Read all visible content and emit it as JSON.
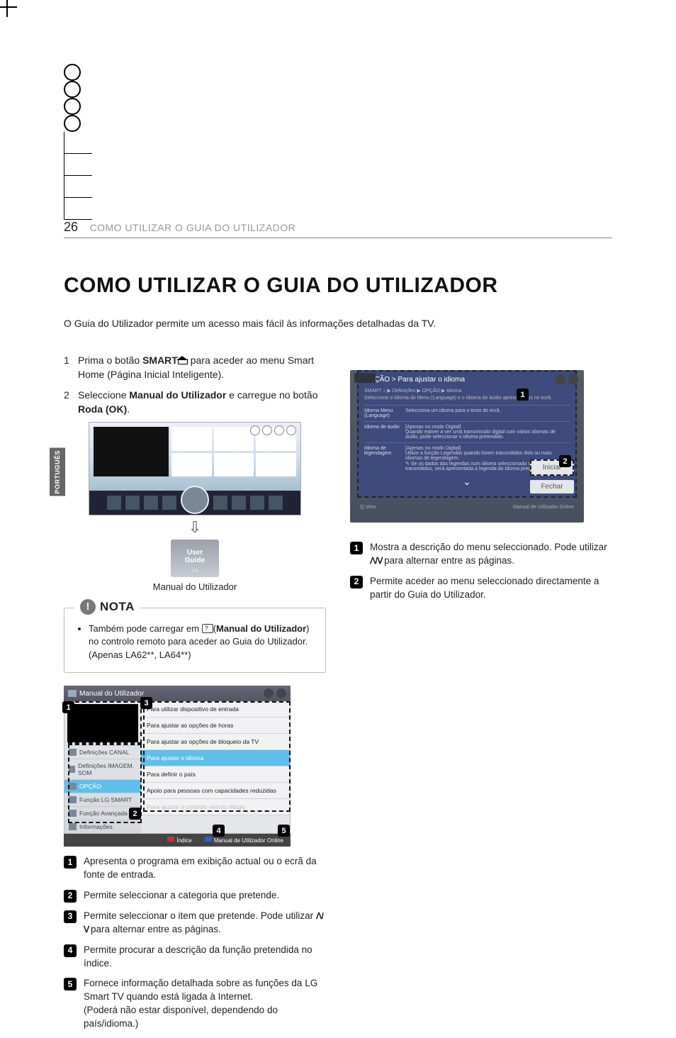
{
  "page_number": "26",
  "header_section": "COMO UTILIZAR O GUIA DO UTILIZADOR",
  "title": "COMO UTILIZAR O GUIA DO UTILIZADOR",
  "intro": "O Guia do Utilizador permite um acesso mais fácil às informações detalhadas da TV.",
  "side_tab": "PORTUGUÊS",
  "steps": [
    {
      "num": "1",
      "pre": "Prima o botão ",
      "bold": "SMART",
      "post": " para aceder ao menu Smart Home (Página Inicial Inteligente)."
    },
    {
      "num": "2",
      "pre": "Seleccione ",
      "bold": "Manual do Utilizador",
      "mid": " e carregue no botão ",
      "bold2": "Roda (OK)",
      "post": "."
    }
  ],
  "user_guide_tile": {
    "line1": "User",
    "line2": "Guide",
    "brand": "LG"
  },
  "caption1": "Manual do Utilizador",
  "note": {
    "label": "NOTA",
    "text_pre": "Também pode carregar em",
    "text_bold": "Manual do Utilizador",
    "text_mid": ") no controlo remoto para aceder ao Guia do Utilizador.(Apenas LA62**, LA64**)"
  },
  "fig2": {
    "window_title": "Manual do Utilizador",
    "categories": [
      "Definições CANAL",
      "Definições IMAGEM, SOM",
      "OPÇÃO",
      "Função LG SMART",
      "Função Avançada",
      "Informações"
    ],
    "active_cat_index": 2,
    "items": [
      "Para utilizar dispositivo de entrada",
      "Para ajustar as opções de horas",
      "Para ajustar as opções de bloqueio da TV",
      "Para ajustar o idioma",
      "Para definir o país",
      "Apoio para pessoas com capacidades reduzidas",
      "Para ajustar o controlo remoto Magic"
    ],
    "active_item_index": 3,
    "disabled_item_index": 6,
    "footer_left": "Índice",
    "footer_right": "Manual de Utilizador Online"
  },
  "legend1": [
    {
      "n": "1",
      "t": "Apresenta o programa em exibição actual ou o ecrã da fonte de entrada."
    },
    {
      "n": "2",
      "t": "Permite seleccionar a categoria que pretende."
    },
    {
      "n": "3",
      "t_pre": "Permite seleccionar o item que pretende. Pode utilizar ",
      "t_post": " para alternar entre as páginas."
    },
    {
      "n": "4",
      "t": "Permite procurar a descrição da função pretendida no índice."
    },
    {
      "n": "5",
      "t": "Fornece informação detalhada sobre as funções da LG Smart TV quando está ligada à Internet.",
      "t_sub": "(Poderá não estar disponível, dependendo do país/idioma.)"
    }
  ],
  "fig3": {
    "breadcrumb": "OPÇÃO > Para ajustar o idioma",
    "path": "SMART ⌂ ▶ Definições ▶ OPÇÃO ▶ Idioma",
    "path_sub": "Seleccione o Idioma do Menu (Language) e o Idioma de áudio apresentados no ecrã.",
    "rows": [
      {
        "l": "Idioma Menu (Language)",
        "r": "Selecciona um idioma para o texto do ecrã."
      },
      {
        "l": "Idioma de áudio",
        "r": "[Apenas no modo Digital]\nQuando estiver a ver uma transmissão digital com vários idiomas de áudio, pode seleccionar o idioma pretendido."
      },
      {
        "l": "Idioma de legendagem",
        "r": "[Apenas no modo Digital]\nUtilize a função Legendas quando forem transmitidos dois ou mais idiomas de legendagem.\n✎ Se os dados das legendas num idioma seleccionado não forem transmitidos, será apresentada a legenda do idioma predefinido."
      }
    ],
    "btn_start": "Iniciar",
    "btn_close": "Fechar",
    "foot_left": "Q.View",
    "foot_right": "Manual de Utilizador Online"
  },
  "legend2": [
    {
      "n": "1",
      "t_pre": "Mostra a descrição do menu seleccionado. Pode utilizar ",
      "t_post": " para alternar entre as páginas."
    },
    {
      "n": "2",
      "t": "Permite aceder ao menu seleccionado directamente a partir do Guia do Utilizador."
    }
  ]
}
